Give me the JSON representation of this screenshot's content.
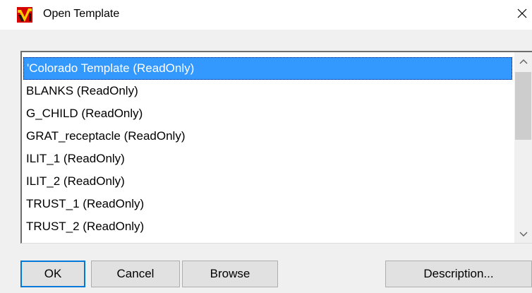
{
  "window": {
    "title": "Open Template",
    "close_glyph": "✕"
  },
  "list": {
    "items": [
      {
        "label": "'Colorado Template (ReadOnly)",
        "selected": true
      },
      {
        "label": "BLANKS (ReadOnly)",
        "selected": false
      },
      {
        "label": "G_CHILD (ReadOnly)",
        "selected": false
      },
      {
        "label": "GRAT_receptacle (ReadOnly)",
        "selected": false
      },
      {
        "label": "ILIT_1 (ReadOnly)",
        "selected": false
      },
      {
        "label": "ILIT_2 (ReadOnly)",
        "selected": false
      },
      {
        "label": "TRUST_1 (ReadOnly)",
        "selected": false
      },
      {
        "label": "TRUST_2 (ReadOnly)",
        "selected": false
      }
    ]
  },
  "buttons": {
    "ok": "OK",
    "cancel": "Cancel",
    "browse": "Browse",
    "description": "Description..."
  },
  "colors": {
    "selection": "#3399ff",
    "default_button_border": "#0078d7",
    "app_icon_red": "#d40000",
    "app_icon_yellow": "#ffcc00"
  },
  "icons": {
    "app": "app-logo-icon",
    "close": "close-icon",
    "scroll_up": "chevron-up-icon",
    "scroll_down": "chevron-down-icon"
  }
}
